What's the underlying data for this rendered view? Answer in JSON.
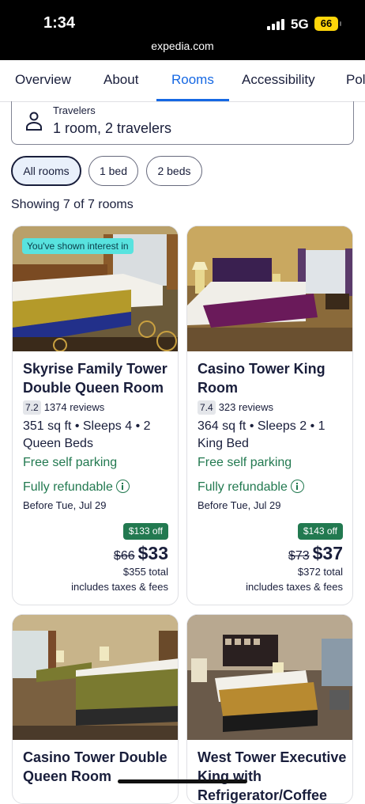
{
  "status_bar": {
    "time": "1:34",
    "network": "5G",
    "battery": "66",
    "url": "expedia.com"
  },
  "tabs": [
    {
      "label": "Overview"
    },
    {
      "label": "About"
    },
    {
      "label": "Rooms",
      "active": true
    },
    {
      "label": "Accessibility"
    },
    {
      "label": "Pol"
    }
  ],
  "travelers": {
    "label": "Travelers",
    "value": "1 room, 2 travelers"
  },
  "filters": [
    {
      "label": "All rooms",
      "selected": true
    },
    {
      "label": "1 bed"
    },
    {
      "label": "2 beds"
    }
  ],
  "showing_text": "Showing 7 of 7 rooms",
  "rooms": [
    {
      "badge": "You've shown interest in",
      "name": "Skyrise Family Tower Double Queen Room",
      "score": "7.2",
      "reviews": "1374 reviews",
      "details": "351 sq ft • Sleeps 4 • 2 Queen Beds",
      "parking": "Free self parking",
      "refundable": "Fully refundable",
      "refund_deadline": "Before Tue, Jul 29",
      "discount": "$133 off",
      "old_price": "$66",
      "price": "$33",
      "total": "$355 total",
      "includes": "includes taxes & fees"
    },
    {
      "name": "Casino Tower King Room",
      "score": "7.4",
      "reviews": "323 reviews",
      "details": "364 sq ft • Sleeps 2 • 1 King Bed",
      "parking": "Free self parking",
      "refundable": "Fully refundable",
      "refund_deadline": "Before Tue, Jul 29",
      "discount": "$143 off",
      "old_price": "$73",
      "price": "$37",
      "total": "$372 total",
      "includes": "includes taxes & fees"
    },
    {
      "name": "Casino Tower Double Queen Room"
    },
    {
      "name": "West Tower Executive King with Refrigerator/Coffee"
    }
  ],
  "colors": {
    "accent": "#1668e3",
    "success": "#227950",
    "text": "#191e3b",
    "interest_badge": "#58e3df"
  }
}
